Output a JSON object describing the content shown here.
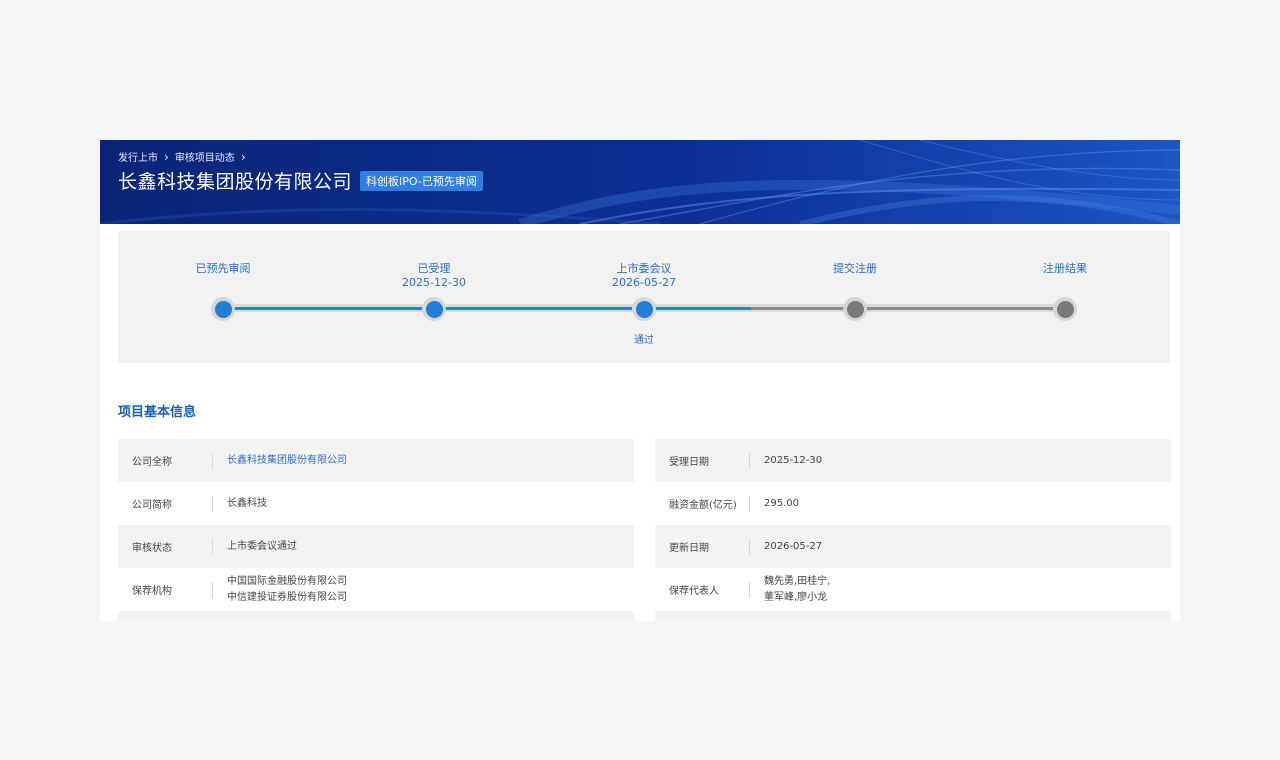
{
  "breadcrumb": [
    "发行上市",
    "审核项目动态"
  ],
  "company_title": "长鑫科技集团股份有限公司",
  "status_badge": "科创板IPO-已预先审阅",
  "steps": [
    {
      "label": "已预先审阅",
      "date": "",
      "done": true
    },
    {
      "label": "已受理",
      "date": "2025-12-30",
      "done": true
    },
    {
      "label": "上市委会议",
      "date": "2026-05-27",
      "done": true,
      "note": "通过"
    },
    {
      "label": "提交注册",
      "date": "",
      "done": false
    },
    {
      "label": "注册结果",
      "date": "",
      "done": false
    }
  ],
  "section_title": "项目基本信息",
  "info_left": [
    {
      "key": "公司全称",
      "value": [
        "长鑫科技集团股份有限公司"
      ],
      "link": true
    },
    {
      "key": "公司简称",
      "value": [
        "长鑫科技"
      ]
    },
    {
      "key": "审核状态",
      "value": [
        "上市委会议通过"
      ]
    },
    {
      "key": "保荐机构",
      "value": [
        "中国国际金融股份有限公司",
        "中信建投证券股份有限公司"
      ]
    }
  ],
  "info_right": [
    {
      "key": "受理日期",
      "value": [
        "2025-12-30"
      ]
    },
    {
      "key": "融资金额(亿元)",
      "value": [
        "295.00"
      ]
    },
    {
      "key": "更新日期",
      "value": [
        "2026-05-27"
      ]
    },
    {
      "key": "保荐代表人",
      "value": [
        "魏先勇,田桂宁,",
        "董军峰,廖小龙"
      ]
    }
  ],
  "colors": {
    "banner": "#0a2a88",
    "accent": "#2a7fd4",
    "pending": "#7a7a7a"
  }
}
